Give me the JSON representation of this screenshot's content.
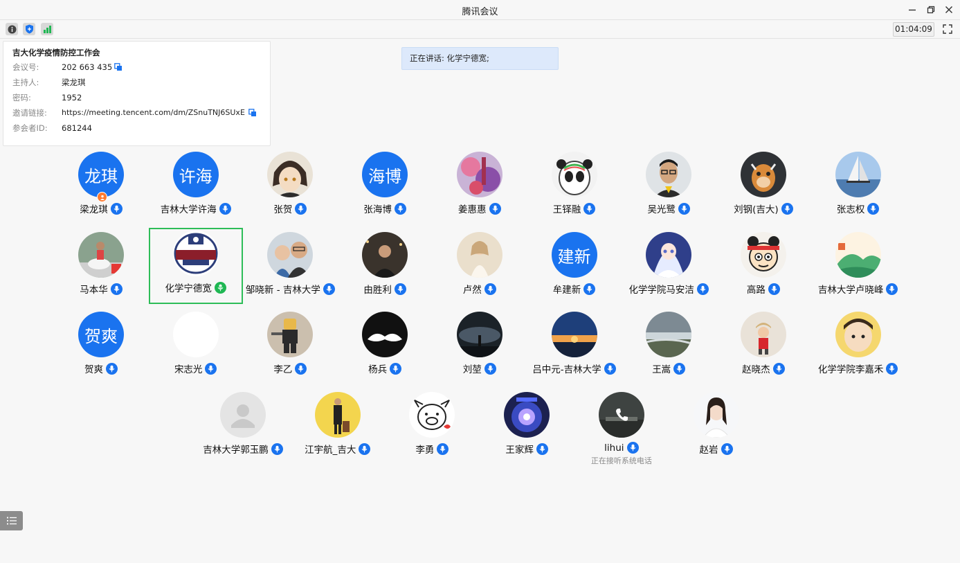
{
  "window": {
    "title": "腾讯会议",
    "timer": "01:04:09"
  },
  "toolbar_icons": [
    "info-icon",
    "shield-icon",
    "signal-icon"
  ],
  "meeting_info": {
    "title": "吉大化学疫情防控工作会",
    "rows": [
      {
        "label": "会议号:",
        "value": "202 663 435",
        "copyable": true
      },
      {
        "label": "主持人:",
        "value": "梁龙琪",
        "copyable": false
      },
      {
        "label": "密码:",
        "value": "1952",
        "copyable": false
      },
      {
        "label": "邀请链接:",
        "value": "https://meeting.tencent.com/dm/ZSnuTNJ6SUxE",
        "copyable": true
      },
      {
        "label": "参会者ID:",
        "value": "681244",
        "copyable": false
      }
    ]
  },
  "speaking_banner": "正在讲话: 化学宁德宽;",
  "colors": {
    "accent": "#1a73ef",
    "speaking_green": "#1fb753",
    "host_badge": "#ff7a2f"
  },
  "participants": [
    {
      "name": "梁龙琪",
      "avatar_text": "龙琪",
      "host": true
    },
    {
      "name": "吉林大学许海",
      "avatar_text": "许海"
    },
    {
      "name": "张贺",
      "avatar_icon": "anime-character-avatar"
    },
    {
      "name": "张海博",
      "avatar_text": "海博"
    },
    {
      "name": "姜惠惠",
      "avatar_icon": "colorful-photo-avatar"
    },
    {
      "name": "王铎融",
      "avatar_icon": "panda-mascot-avatar"
    },
    {
      "name": "吴光鹭",
      "avatar_icon": "man-photo-avatar"
    },
    {
      "name": "刘钢(吉大)",
      "avatar_icon": "toy-figure-avatar"
    },
    {
      "name": "张志权",
      "avatar_icon": "sailboat-avatar"
    },
    {
      "name": "马本华",
      "avatar_icon": "person-photo-avatar"
    },
    {
      "name": "化学宁德宽",
      "avatar_icon": "university-logo-avatar",
      "speaking": true
    },
    {
      "name": "邹晓新 - 吉林大学",
      "avatar_icon": "family-photo-avatar"
    },
    {
      "name": "由胜利",
      "avatar_icon": "night-photo-avatar"
    },
    {
      "name": "卢然",
      "avatar_icon": "girl-photo-avatar"
    },
    {
      "name": "牟建新",
      "avatar_text": "建新"
    },
    {
      "name": "化学学院马安洁",
      "avatar_icon": "anime-girl-avatar"
    },
    {
      "name": "高路",
      "avatar_icon": "cartoon-face-avatar"
    },
    {
      "name": "吉林大学卢晓峰",
      "avatar_icon": "landscape-avatar"
    },
    {
      "name": "贺爽",
      "avatar_text": "贺爽"
    },
    {
      "name": "宋志光",
      "avatar_icon": "blank-white-avatar"
    },
    {
      "name": "李乙",
      "avatar_icon": "lego-figure-avatar"
    },
    {
      "name": "杨兵",
      "avatar_icon": "mustache-avatar"
    },
    {
      "name": "刘堃",
      "avatar_icon": "dark-sky-avatar"
    },
    {
      "name": "吕中元-吉林大学",
      "avatar_icon": "sunset-avatar"
    },
    {
      "name": "王嵩",
      "avatar_icon": "river-landscape-avatar"
    },
    {
      "name": "赵晓杰",
      "avatar_icon": "child-photo-avatar"
    },
    {
      "name": "化学学院李嘉禾",
      "avatar_icon": "baby-photo-avatar"
    },
    {
      "name": "吉林大学郭玉鹏",
      "avatar_icon": "default-person-avatar"
    },
    {
      "name": "江宇航_吉大",
      "avatar_icon": "man-with-luggage-avatar"
    },
    {
      "name": "李勇",
      "avatar_icon": "cartoon-pig-avatar"
    },
    {
      "name": "王家辉",
      "avatar_icon": "robot-glow-avatar"
    },
    {
      "name": "lihui",
      "avatar_icon": "phone-call-avatar",
      "status": "正在接听系统电话"
    },
    {
      "name": "赵岩",
      "avatar_icon": "woman-photo-avatar"
    }
  ]
}
